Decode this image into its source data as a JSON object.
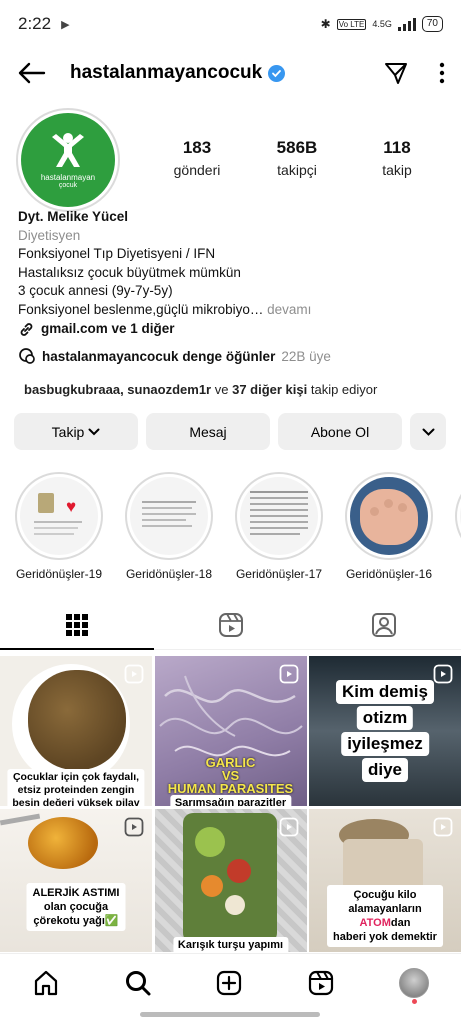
{
  "status": {
    "time": "2:22",
    "network": "4.5G",
    "battery": "70"
  },
  "header": {
    "username": "hastalanmayancocuk"
  },
  "profile": {
    "avatar_line1": "hastalanmayan",
    "avatar_line2": "çocuk",
    "stats": [
      {
        "value": "183",
        "label": "gönderi"
      },
      {
        "value": "586B",
        "label": "takipçi"
      },
      {
        "value": "118",
        "label": "takip"
      }
    ],
    "name": "Dyt. Melike Yücel",
    "category": "Diyetisyen",
    "bio_lines": [
      "Fonksiyonel Tıp Diyetisyeni / IFN",
      "Hastalıksız çocuk büyütmek mümkün",
      "3 çocuk annesi (9y-7y-5y)"
    ],
    "bio_truncated": "Fonksiyonel beslenme,güçlü mikrobiyo…",
    "more_label": " devamı",
    "link_text": "gmail.com ve 1 diğer"
  },
  "channel": {
    "name": "hastalanmayancocuk denge öğünler",
    "age": "22B üye"
  },
  "followed_by": {
    "users": "basbugkubraaa, sunaozdem1r",
    "middle": " ve ",
    "others": "37 diğer kişi",
    "suffix": " takip ediyor"
  },
  "buttons": {
    "follow": "Takip",
    "message": "Mesaj",
    "subscribe": "Abone Ol"
  },
  "highlights": [
    {
      "label": "Geridönüşler-19"
    },
    {
      "label": "Geridönüşler-18"
    },
    {
      "label": "Geridönüşler-17"
    },
    {
      "label": "Geridönüşler-16"
    }
  ],
  "posts": [
    {
      "caption": "Çocuklar için çok faydalı,",
      "caption2": "etsiz proteinden zengin",
      "caption3": "besin değeri yüksek pilav"
    },
    {
      "caption": "GARLIC",
      "caption2": "VS",
      "caption3": "HUMAN PARASITES",
      "caption4": "Sarımsağın parazitler"
    },
    {
      "caption": "Kim demiş",
      "caption2": "otizm",
      "caption3": "iyileşmez",
      "caption4": "diye"
    },
    {
      "caption": "ALERJİK ASTIMI",
      "caption2": "olan çocuğa",
      "caption3": "çörekotu yağı✅"
    },
    {
      "caption": "Karışık turşu yapımı"
    },
    {
      "caption": "Çocuğu kilo",
      "caption2": "alamayanların",
      "caption3": "ATOM",
      "caption3b": "dan",
      "caption4": "haberi yok demektir"
    }
  ],
  "colors": {
    "accent": "#3897f0",
    "avatar_bg": "#2e9e3e",
    "secondary_text": "#8e8e8e",
    "button_bg": "#efefef",
    "atom_red": "#e0245e"
  },
  "icons": [
    "back-arrow-icon",
    "verified-icon",
    "send-icon",
    "more-vertical-icon",
    "link-icon",
    "threads-icon",
    "chevron-down-icon",
    "grid-icon",
    "reels-icon",
    "tagged-icon",
    "home-icon",
    "search-icon",
    "create-icon",
    "reels-nav-icon",
    "profile-avatar-icon"
  ]
}
